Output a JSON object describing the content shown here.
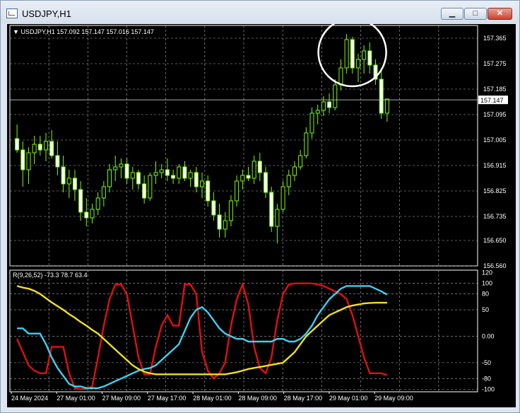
{
  "window": {
    "title": "USDJPY,H1",
    "minimize_glyph": "▁",
    "maximize_glyph": "□",
    "close_glyph": "✕",
    "icon": "chart-window-icon"
  },
  "chart": {
    "info_arrow": "▼",
    "info_text": "USDJPY,H1  157.092 157.147 157.016 157.147",
    "price_ticks": [
      "157.365",
      "157.275",
      "157.185",
      "157.095",
      "157.005",
      "156.915",
      "156.825",
      "156.735",
      "156.650",
      "156.560"
    ],
    "current_price": "157.147",
    "time_labels": [
      "24 May 2024",
      "27 May 01:00",
      "27 May 09:00",
      "27 May 17:00",
      "28 May 01:00",
      "28 May 09:00",
      "28 May 17:00",
      "29 May 01:00",
      "29 May 09:00"
    ]
  },
  "indicator": {
    "label": "R(9,26,52) -73.3 78.7 63.4",
    "ticks": [
      "120",
      "100",
      "80",
      "50",
      "0.00",
      "-50",
      "-80",
      "-100"
    ]
  },
  "colors": {
    "background": "#000000",
    "grid": "#b0b0b0",
    "candle": "#7cfc00",
    "bull_body": "#000000",
    "bear_body": "#ffffff",
    "line_red": "#e01010",
    "line_cyan": "#40d0f0",
    "line_yellow": "#f0e020",
    "annotation": "#ffffff"
  },
  "chart_data": {
    "type": "candlestick",
    "symbol": "USDJPY",
    "timeframe": "H1",
    "ylim": [
      156.56,
      157.41
    ],
    "candles": [
      [
        157.01,
        157.06,
        156.96,
        156.97
      ],
      [
        156.97,
        157.0,
        156.84,
        156.9
      ],
      [
        156.9,
        156.98,
        156.85,
        156.96
      ],
      [
        156.96,
        157.02,
        156.92,
        156.99
      ],
      [
        156.99,
        157.02,
        156.95,
        156.97
      ],
      [
        156.97,
        157.03,
        156.93,
        157.0
      ],
      [
        157.0,
        157.04,
        156.94,
        156.95
      ],
      [
        156.95,
        157.0,
        156.88,
        156.91
      ],
      [
        156.91,
        156.95,
        156.82,
        156.85
      ],
      [
        156.85,
        156.9,
        156.8,
        156.87
      ],
      [
        156.87,
        156.9,
        156.79,
        156.83
      ],
      [
        156.83,
        156.86,
        156.72,
        156.75
      ],
      [
        156.75,
        156.8,
        156.7,
        156.73
      ],
      [
        156.73,
        156.78,
        156.71,
        156.76
      ],
      [
        156.76,
        156.82,
        156.74,
        156.8
      ],
      [
        156.8,
        156.86,
        156.77,
        156.84
      ],
      [
        156.84,
        156.92,
        156.82,
        156.9
      ],
      [
        156.9,
        156.95,
        156.86,
        156.91
      ],
      [
        156.91,
        156.94,
        156.87,
        156.92
      ],
      [
        156.92,
        156.94,
        156.85,
        156.87
      ],
      [
        156.87,
        156.91,
        156.83,
        156.89
      ],
      [
        156.89,
        156.9,
        156.83,
        156.85
      ],
      [
        156.85,
        156.88,
        156.78,
        156.8
      ],
      [
        156.8,
        156.89,
        156.79,
        156.88
      ],
      [
        156.88,
        156.93,
        156.85,
        156.89
      ],
      [
        156.89,
        156.92,
        156.87,
        156.9
      ],
      [
        156.9,
        156.94,
        156.86,
        156.88
      ],
      [
        156.88,
        156.9,
        156.85,
        156.87
      ],
      [
        156.87,
        156.92,
        156.85,
        156.91
      ],
      [
        156.91,
        156.93,
        156.86,
        156.87
      ],
      [
        156.87,
        156.9,
        156.84,
        156.89
      ],
      [
        156.89,
        156.91,
        156.82,
        156.84
      ],
      [
        156.84,
        156.89,
        156.8,
        156.86
      ],
      [
        156.86,
        156.88,
        156.77,
        156.79
      ],
      [
        156.79,
        156.82,
        156.72,
        156.74
      ],
      [
        156.74,
        156.78,
        156.66,
        156.69
      ],
      [
        156.69,
        156.75,
        156.66,
        156.72
      ],
      [
        156.72,
        156.81,
        156.7,
        156.79
      ],
      [
        156.79,
        156.88,
        156.77,
        156.86
      ],
      [
        156.86,
        156.9,
        156.83,
        156.88
      ],
      [
        156.88,
        156.91,
        156.86,
        156.87
      ],
      [
        156.87,
        156.95,
        156.85,
        156.93
      ],
      [
        156.93,
        156.96,
        156.86,
        156.89
      ],
      [
        156.89,
        156.91,
        156.8,
        156.82
      ],
      [
        156.82,
        156.84,
        156.68,
        156.7
      ],
      [
        156.7,
        156.78,
        156.64,
        156.76
      ],
      [
        156.76,
        156.86,
        156.75,
        156.84
      ],
      [
        156.84,
        156.9,
        156.81,
        156.88
      ],
      [
        156.88,
        156.93,
        156.86,
        156.91
      ],
      [
        156.91,
        156.97,
        156.9,
        156.95
      ],
      [
        156.95,
        157.05,
        156.94,
        157.03
      ],
      [
        157.03,
        157.12,
        157.01,
        157.1
      ],
      [
        157.1,
        157.13,
        157.06,
        157.11
      ],
      [
        157.11,
        157.16,
        157.09,
        157.14
      ],
      [
        157.14,
        157.17,
        157.1,
        157.12
      ],
      [
        157.12,
        157.22,
        157.11,
        157.2
      ],
      [
        157.2,
        157.29,
        157.18,
        157.26
      ],
      [
        157.26,
        157.38,
        157.24,
        157.36
      ],
      [
        157.36,
        157.37,
        157.24,
        157.26
      ],
      [
        157.26,
        157.31,
        157.21,
        157.29
      ],
      [
        157.29,
        157.34,
        157.24,
        157.32
      ],
      [
        157.32,
        157.35,
        157.24,
        157.27
      ],
      [
        157.27,
        157.29,
        157.2,
        157.22
      ],
      [
        157.22,
        157.26,
        157.08,
        157.1
      ],
      [
        157.1,
        157.15,
        157.07,
        157.15
      ]
    ],
    "indicator_name": "R(9,26,52)",
    "indicator_values": [
      -73.3,
      78.7,
      63.4
    ],
    "indicator_ylim": [
      -105,
      125
    ],
    "series": [
      {
        "color": "red",
        "values": [
          -5,
          -30,
          -55,
          -65,
          -70,
          -70,
          -20,
          -20,
          -20,
          -70,
          -98,
          -100,
          -100,
          -95,
          -40,
          20,
          70,
          98,
          98,
          80,
          20,
          -40,
          -72,
          -72,
          -20,
          20,
          40,
          20,
          20,
          98,
          98,
          80,
          -30,
          -65,
          -80,
          -70,
          -50,
          20,
          70,
          98,
          60,
          -20,
          -60,
          -70,
          -40,
          30,
          80,
          98,
          100,
          100,
          100,
          100,
          98,
          95,
          90,
          85,
          80,
          70,
          40,
          0,
          -40,
          -70,
          -70,
          -70,
          -73.3
        ]
      },
      {
        "color": "cyan",
        "values": [
          15,
          15,
          5,
          5,
          5,
          -15,
          -40,
          -60,
          -75,
          -90,
          -95,
          -95,
          -98,
          -98,
          -98,
          -95,
          -90,
          -85,
          -80,
          -75,
          -70,
          -65,
          -62,
          -60,
          -55,
          -45,
          -35,
          -25,
          -15,
          10,
          35,
          50,
          55,
          45,
          30,
          15,
          5,
          0,
          -5,
          -5,
          -10,
          -10,
          -10,
          -10,
          -10,
          -5,
          -5,
          -10,
          -10,
          -5,
          5,
          20,
          40,
          55,
          70,
          80,
          90,
          95,
          95,
          95,
          95,
          95,
          90,
          85,
          78.7
        ]
      },
      {
        "color": "yellow",
        "values": [
          95,
          92,
          90,
          86,
          80,
          72,
          64,
          57,
          50,
          42,
          35,
          27,
          20,
          12,
          5,
          -5,
          -15,
          -25,
          -35,
          -45,
          -55,
          -62,
          -67,
          -70,
          -72,
          -72,
          -72,
          -72,
          -72,
          -72,
          -72,
          -72,
          -72,
          -72,
          -72,
          -72,
          -72,
          -70,
          -68,
          -65,
          -62,
          -60,
          -58,
          -56,
          -54,
          -52,
          -50,
          -40,
          -30,
          -15,
          0,
          10,
          20,
          30,
          40,
          45,
          50,
          55,
          58,
          60,
          62,
          63,
          63.4,
          63.4,
          63.4
        ]
      }
    ]
  }
}
